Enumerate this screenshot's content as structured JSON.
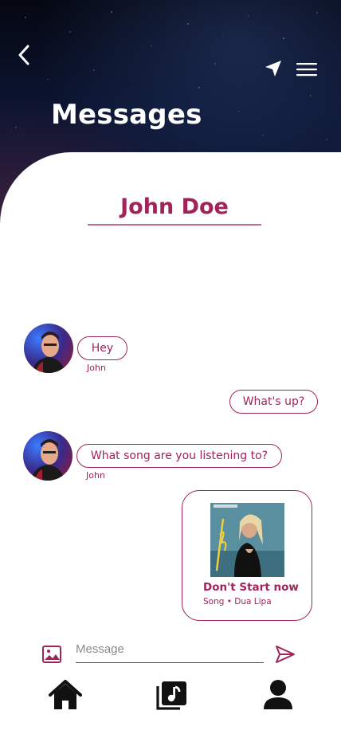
{
  "header": {
    "title": "Messages"
  },
  "contact": {
    "name": "John Doe"
  },
  "messages": [
    {
      "text": "Hey",
      "sender": "John"
    },
    {
      "text": "What's up?"
    },
    {
      "text": "What song are you listening to?",
      "sender": "John"
    }
  ],
  "shared_song": {
    "title": "Don't Start now",
    "meta": "Song • Dua Lipa"
  },
  "composer": {
    "placeholder": "Message"
  },
  "colors": {
    "accent": "#a0235a",
    "header_bg": "#0b1430",
    "icon_dark": "#111111"
  },
  "icons": {
    "back": "chevron-left-icon",
    "navigate": "navigation-arrow-icon",
    "menu": "hamburger-menu-icon",
    "attach_image": "image-icon",
    "send": "send-icon",
    "home": "home-icon",
    "music": "music-library-icon",
    "profile": "user-icon"
  }
}
